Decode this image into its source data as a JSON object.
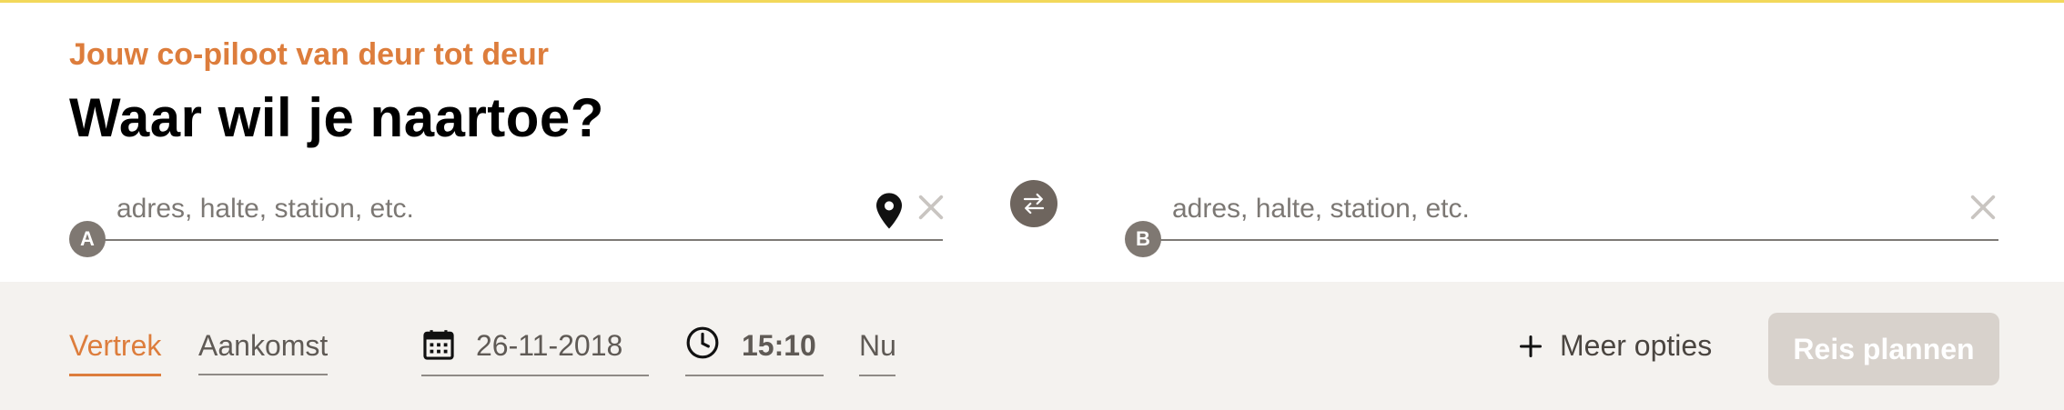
{
  "header": {
    "subtitle": "Jouw co-piloot van deur tot deur",
    "title": "Waar wil je naartoe?"
  },
  "from": {
    "badge": "A",
    "placeholder": "adres, halte, station, etc.",
    "value": "",
    "icons": [
      "location-pin-icon",
      "clear-icon"
    ]
  },
  "to": {
    "badge": "B",
    "placeholder": "adres, halte, station, etc.",
    "value": "",
    "icons": [
      "clear-icon"
    ]
  },
  "swap": {
    "icon": "swap-arrows-icon"
  },
  "options": {
    "tabs": [
      {
        "label": "Vertrek",
        "active": true
      },
      {
        "label": "Aankomst",
        "active": false
      }
    ],
    "date": "26-11-2018",
    "time": "15:10",
    "now_label": "Nu",
    "more_label": "Meer opties",
    "plan_label": "Reis plannen"
  },
  "colors": {
    "accent": "#dd7d3c",
    "badge": "#7f7872",
    "swap_button": "#6e655e",
    "panel_bg": "#f4f2ef",
    "plan_button_disabled": "#d8d2cc",
    "top_border": "#f2d85a"
  }
}
